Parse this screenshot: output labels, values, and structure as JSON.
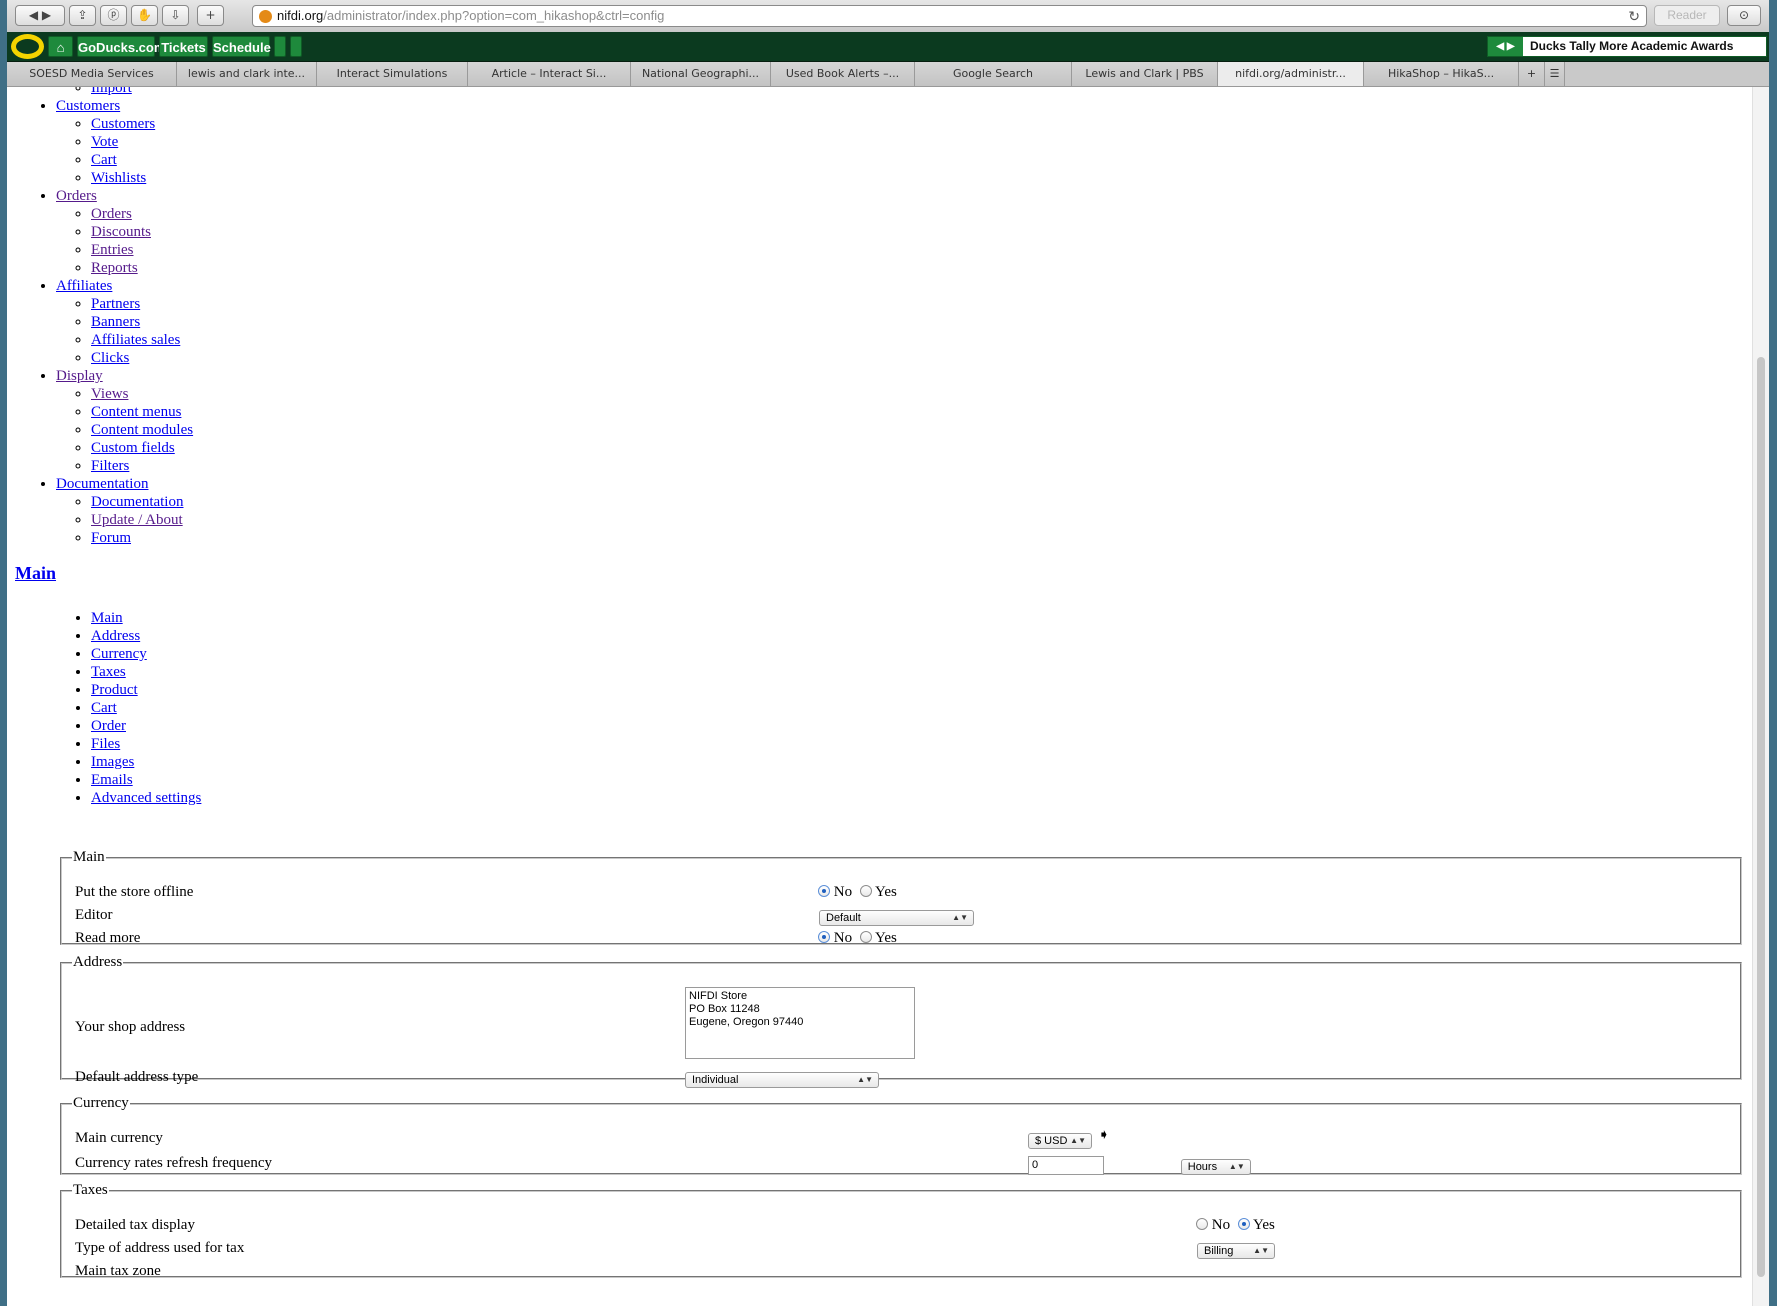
{
  "browser": {
    "url_host": "nifdi.org",
    "url_path": "/administrator/index.php?option=com_hikashop&ctrl=config",
    "reader_label": "Reader"
  },
  "bookmarks": {
    "items": [
      "GoDucks.com",
      "Tickets",
      "Schedule"
    ],
    "news": "Ducks Tally More Academic Awards"
  },
  "tabs": [
    "SOESD Media Services",
    "lewis and clark inte...",
    "Interact Simulations",
    "Article – Interact Si...",
    "National Geographi...",
    "Used Book Alerts –...",
    "Google Search",
    "Lewis and Clark | PBS",
    "nifdi.org/administr...",
    "HikaShop – HikaS..."
  ],
  "menu": [
    {
      "label": "Customers",
      "children": [
        "Customers",
        "Vote",
        "Cart",
        "Wishlists"
      ]
    },
    {
      "label": "Orders",
      "children": [
        "Orders",
        "Discounts",
        "Entries",
        "Reports"
      ]
    },
    {
      "label": "Affiliates",
      "children": [
        "Partners",
        "Banners",
        "Affiliates sales",
        "Clicks"
      ]
    },
    {
      "label": "Display",
      "children": [
        "Views",
        "Content menus",
        "Content modules",
        "Custom fields",
        "Filters"
      ]
    },
    {
      "label": "Documentation",
      "children": [
        "Documentation",
        "Update / About",
        "Forum"
      ]
    }
  ],
  "menu_top_partial": "Import",
  "main_heading": "Main",
  "config_tabs": [
    "Main",
    "Address",
    "Currency",
    "Taxes",
    "Product",
    "Cart",
    "Order",
    "Files",
    "Images",
    "Emails",
    "Advanced settings"
  ],
  "sections": {
    "main": {
      "legend": "Main",
      "offline_label": "Put the store offline",
      "editor_label": "Editor",
      "editor_value": "Default",
      "readmore_label": "Read more",
      "no": "No",
      "yes": "Yes"
    },
    "address": {
      "legend": "Address",
      "shop_address_label": "Your shop address",
      "shop_address_lines": [
        "NIFDI Store",
        "PO Box 11248",
        "Eugene, Oregon 97440"
      ],
      "default_type_label": "Default address type",
      "default_type_value": "Individual"
    },
    "currency": {
      "legend": "Currency",
      "main_label": "Main currency",
      "main_value": "$ USD",
      "refresh_label": "Currency rates refresh frequency",
      "refresh_value": "0",
      "refresh_unit": "Hours"
    },
    "taxes": {
      "legend": "Taxes",
      "detailed_label": "Detailed tax display",
      "no": "No",
      "yes": "Yes",
      "address_type_label": "Type of address used for tax",
      "address_type_value": "Billing",
      "zone_label": "Main tax zone"
    }
  }
}
